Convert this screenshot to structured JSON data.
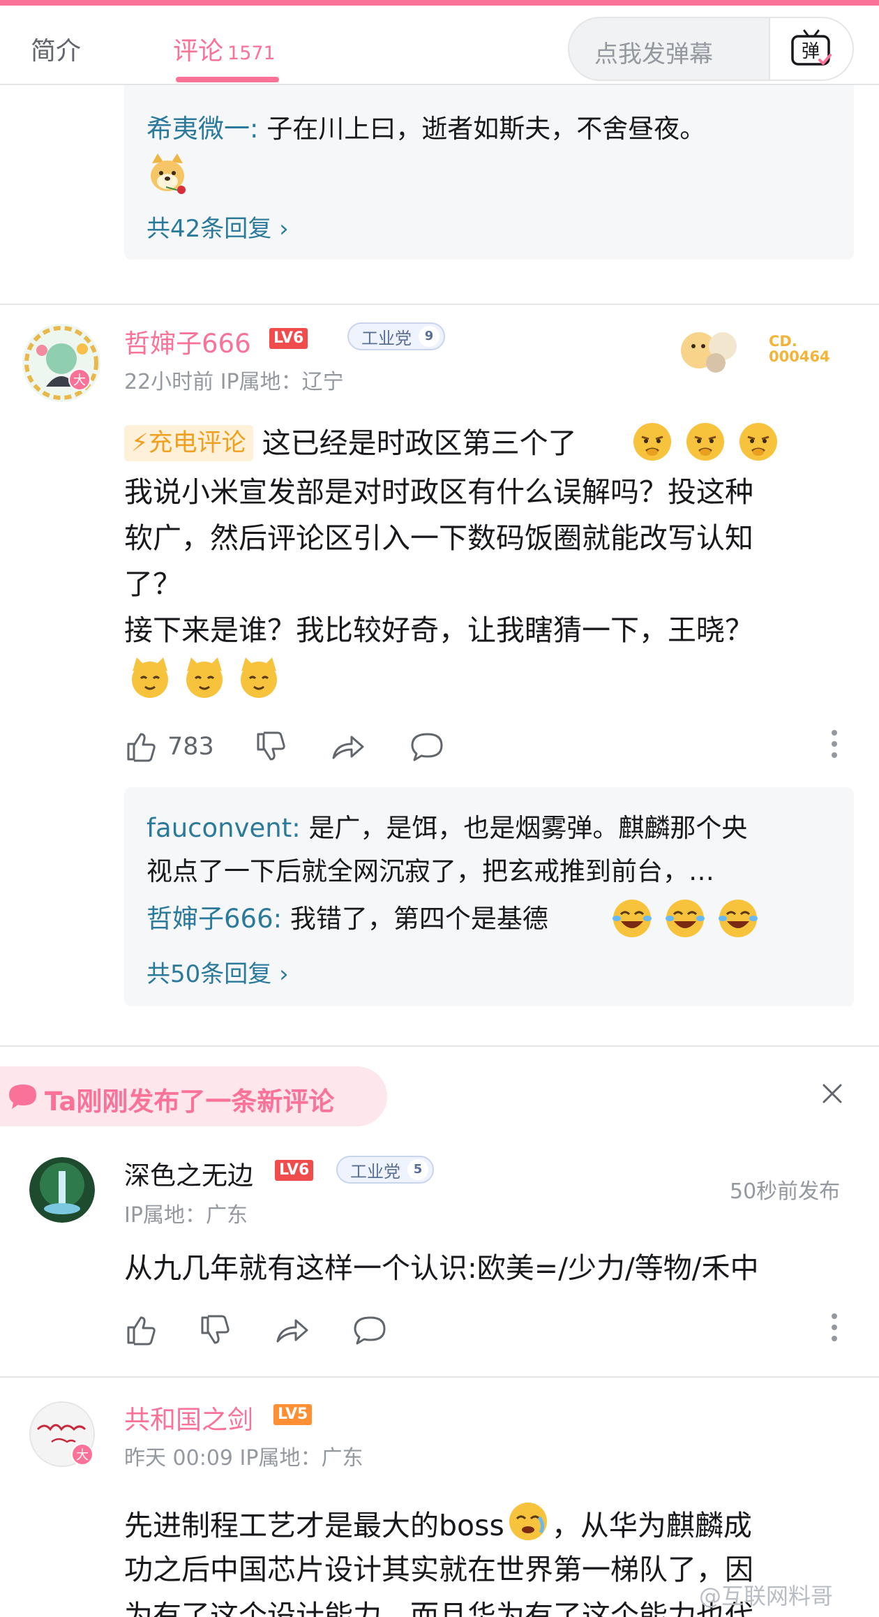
{
  "header": {
    "tab_intro": "简介",
    "tab_comments": "评论",
    "comments_count": "1571",
    "danmaku_placeholder": "点我发弹幕",
    "danmaku_button": "弹"
  },
  "colors": {
    "accent": "#fb7299",
    "reply_name": "#2b7a9c",
    "lv6": "#f04c4c",
    "lv5": "#ff8f33"
  },
  "comments": [
    {
      "replies": [
        {
          "name": "希夷微一",
          "sep": ": ",
          "text": "子在川上曰，逝者如斯夫，不舍昼夜。"
        }
      ],
      "more": "共42条回复 ›"
    },
    {
      "user": "哲婶子666",
      "level": "LV6",
      "medal": "工业党",
      "medal_level": "9",
      "avatar_badge": "大",
      "meta": "22小时前 IP属地：辽宁",
      "badge_number": "CD.\n000464",
      "charge_label": "充电评论",
      "lines": [
        "这已经是时政区第三个了",
        "我说小米宣发部是对时政区有什么误解吗？投这种",
        "软广，然后评论区引入一下数码饭圈就能改写认知",
        "了？",
        "接下来是谁？我比较好奇，让我瞎猜一下，王晓？"
      ],
      "likes": "783",
      "replies": [
        {
          "name": "fauconvent",
          "sep": ": ",
          "text": "是广，是饵，也是烟雾弹。麒麟那个央"
        },
        {
          "name": "",
          "sep": "",
          "text": "视点了一下后就全网沉寂了，把玄戒推到前台，…"
        },
        {
          "name": "哲婶子666",
          "sep": ": ",
          "text": "我错了，第四个是基德"
        }
      ],
      "more": "共50条回复 ›"
    },
    {
      "notice": "Ta刚刚发布了一条新评论",
      "user": "深色之无边",
      "level": "LV6",
      "medal": "工业党",
      "medal_level": "5",
      "meta": "IP属地：广东",
      "time_right": "50秒前发布",
      "lines": [
        "从九几年就有这样一个认识:欧美=/少力/等物/禾中"
      ]
    },
    {
      "user": "共和国之剑",
      "level": "LV5",
      "avatar_badge": "大",
      "meta": "昨天 00:09 IP属地：广东",
      "lines": [
        "先进制程工艺才是最大的boss",
        "，从华为麒麟成",
        "功之后中国芯片设计其实就在世界第一梯队了，因",
        "为有了这个设计能力，而且华为有了这个能力也代"
      ]
    }
  ],
  "watermark": "@互联网料哥"
}
